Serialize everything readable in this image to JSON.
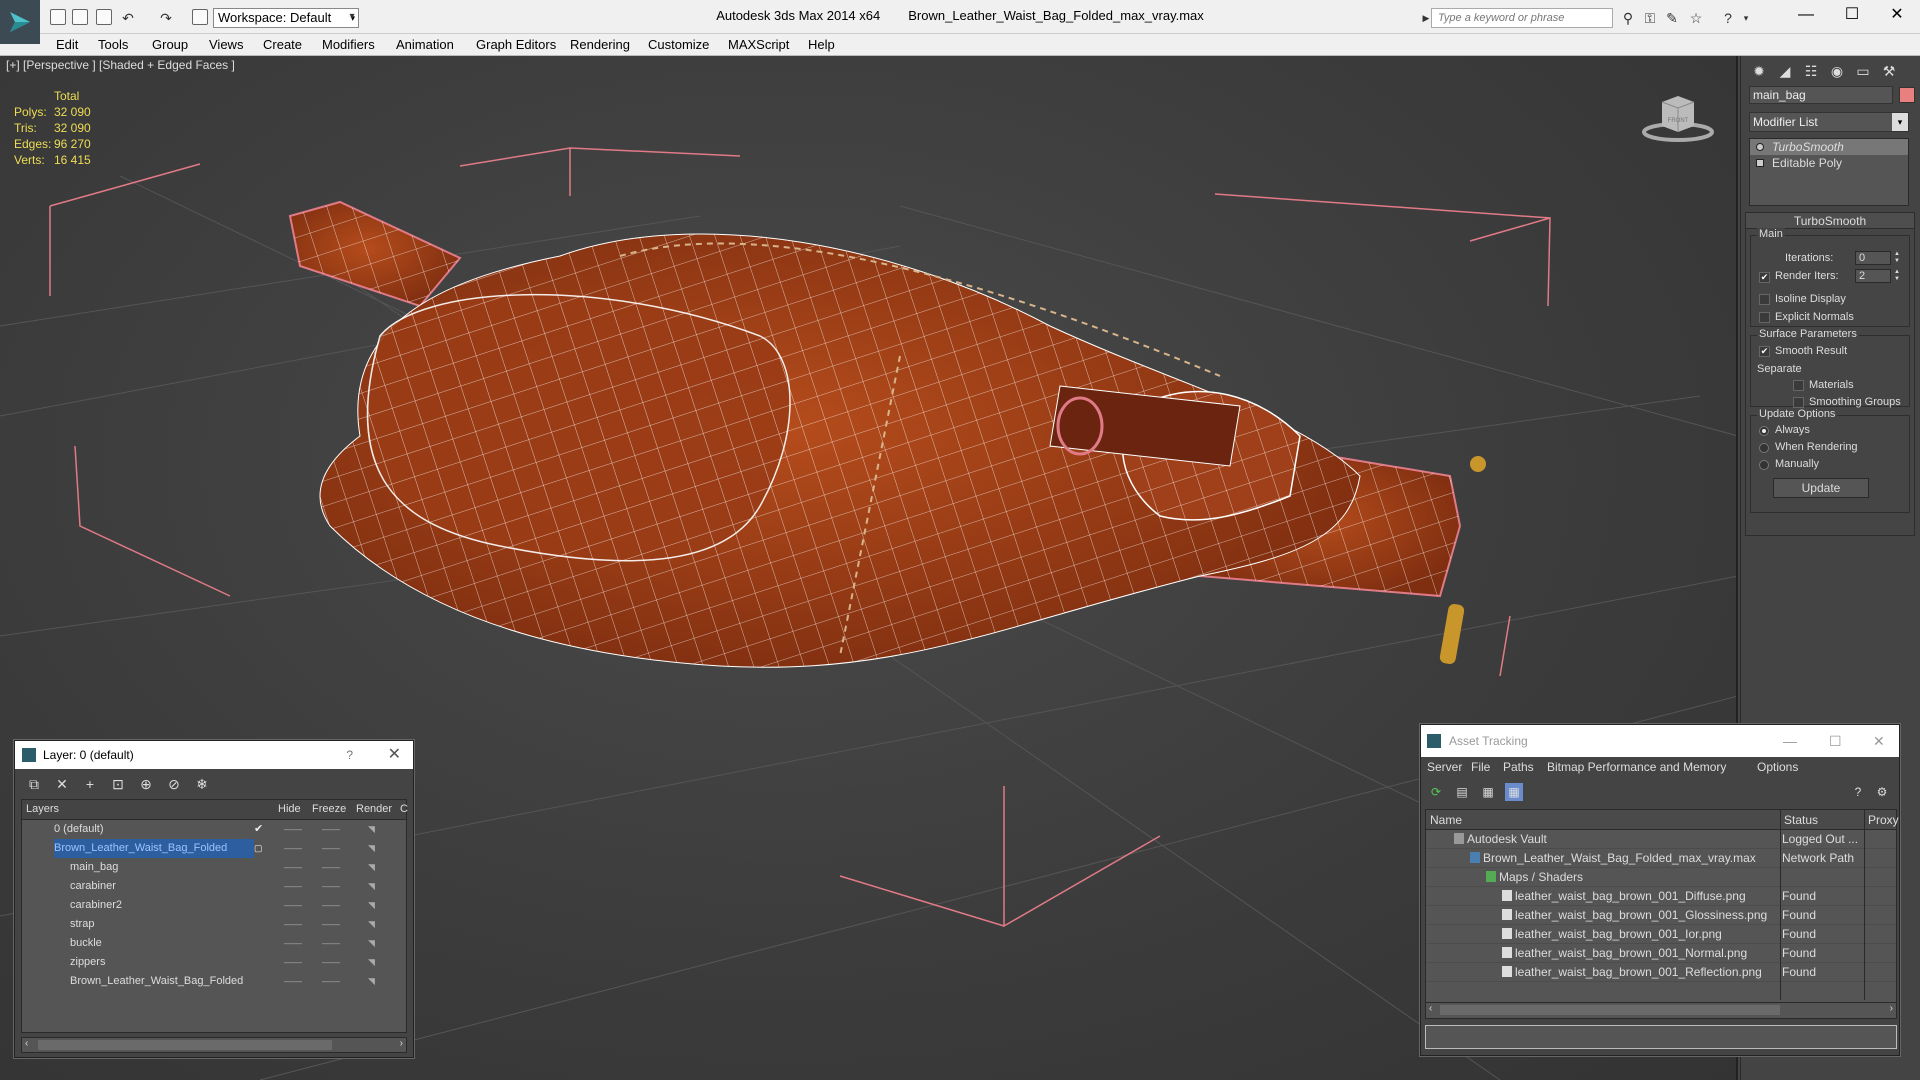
{
  "app": {
    "name": "Autodesk 3ds Max  2014 x64",
    "file": "Brown_Leather_Waist_Bag_Folded_max_vray.max",
    "workspace": "Workspace: Default",
    "search_placeholder": "Type a keyword or phrase"
  },
  "menu": [
    "Edit",
    "Tools",
    "Group",
    "Views",
    "Create",
    "Modifiers",
    "Animation",
    "Graph Editors",
    "Rendering",
    "Customize",
    "MAXScript",
    "Help"
  ],
  "viewport": {
    "label": "[+] [Perspective ] [Shaded + Edged Faces ]",
    "stats": {
      "header": "Total",
      "rows": [
        {
          "k": "Polys:",
          "v": "32 090"
        },
        {
          "k": "Tris:",
          "v": "32 090"
        },
        {
          "k": "Edges:",
          "v": "96 270"
        },
        {
          "k": "Verts:",
          "v": "16 415"
        }
      ]
    },
    "viewcube_text": "FRONT",
    "colors": {
      "wire": "#ffffff",
      "leather": "#a8421a",
      "selection_bracket": "#e07a86",
      "grid": "#5a5a5a"
    }
  },
  "command_panel": {
    "object_name": "main_bag",
    "object_color": "#e98080",
    "modifier_list": "Modifier List",
    "stack": [
      "TurboSmooth",
      "Editable Poly"
    ],
    "rollout_title": "TurboSmooth",
    "main": {
      "title": "Main",
      "iterations_label": "Iterations:",
      "iterations": "0",
      "render_iters_label": "Render Iters:",
      "render_iters": "2",
      "render_iters_checked": true,
      "isoline": "Isoline Display",
      "explicit": "Explicit Normals"
    },
    "surface": {
      "title": "Surface Parameters",
      "smooth": "Smooth Result",
      "smooth_checked": true,
      "separate": "Separate",
      "materials": "Materials",
      "smoothing_groups": "Smoothing Groups"
    },
    "update": {
      "title": "Update Options",
      "always": "Always",
      "when_rendering": "When Rendering",
      "manually": "Manually",
      "button": "Update"
    }
  },
  "layer_panel": {
    "title": "Layer: 0 (default)",
    "help": "?",
    "columns": [
      "Layers",
      "Hide",
      "Freeze",
      "Render",
      "C"
    ],
    "rows": [
      {
        "name": "0 (default)",
        "indent": 0
      },
      {
        "name": "Brown_Leather_Waist_Bag_Folded",
        "indent": 0
      },
      {
        "name": "main_bag",
        "indent": 1
      },
      {
        "name": "carabiner",
        "indent": 1
      },
      {
        "name": "carabiner2",
        "indent": 1
      },
      {
        "name": "strap",
        "indent": 1
      },
      {
        "name": "buckle",
        "indent": 1
      },
      {
        "name": "zippers",
        "indent": 1
      },
      {
        "name": "Brown_Leather_Waist_Bag_Folded",
        "indent": 1
      }
    ]
  },
  "asset_panel": {
    "title": "Asset Tracking",
    "menu": [
      "Server",
      "File",
      "Paths",
      "Bitmap Performance and Memory",
      "Options"
    ],
    "columns": [
      "Name",
      "Status",
      "Proxy"
    ],
    "rows": [
      {
        "name": "Autodesk Vault",
        "status": "Logged Out ...",
        "indent": 1
      },
      {
        "name": "Brown_Leather_Waist_Bag_Folded_max_vray.max",
        "status": "Network Path",
        "indent": 2
      },
      {
        "name": "Maps / Shaders",
        "status": "",
        "indent": 3
      },
      {
        "name": "leather_waist_bag_brown_001_Diffuse.png",
        "status": "Found",
        "indent": 4
      },
      {
        "name": "leather_waist_bag_brown_001_Glossiness.png",
        "status": "Found",
        "indent": 4
      },
      {
        "name": "leather_waist_bag_brown_001_Ior.png",
        "status": "Found",
        "indent": 4
      },
      {
        "name": "leather_waist_bag_brown_001_Normal.png",
        "status": "Found",
        "indent": 4
      },
      {
        "name": "leather_waist_bag_brown_001_Reflection.png",
        "status": "Found",
        "indent": 4
      }
    ]
  }
}
